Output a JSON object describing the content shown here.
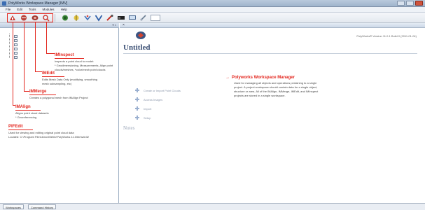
{
  "window": {
    "title": "PolyWorks Workspace Manager [IMV]",
    "controls": [
      "minimize",
      "maximize",
      "close"
    ]
  },
  "menu": [
    "File",
    "Edit",
    "Tools",
    "Modules",
    "Help"
  ],
  "toolbar": {
    "buttons": [
      {
        "icon": "imedit-icon"
      },
      {
        "icon": "imalign-icon"
      },
      {
        "icon": "immerge-icon"
      },
      {
        "icon": "iminspect-icon"
      },
      {
        "icon": "module-5-icon"
      },
      {
        "icon": "module-6-icon"
      },
      {
        "icon": "module-7-icon"
      },
      {
        "icon": "module-8-icon"
      },
      {
        "icon": "module-9-icon"
      },
      {
        "icon": "module-10-icon"
      }
    ]
  },
  "left_pane": {
    "header": "",
    "header_controls": "▾ ×",
    "tree": {
      "root": "",
      "items": [
        "",
        "",
        "",
        "",
        "",
        ""
      ]
    }
  },
  "callouts": [
    {
      "title": "IMInspect",
      "desc": [
        "Inspects a point cloud to model:",
        "* Geodimensioning, Measurements, Align point",
        "clouds/meshes, *color/mesh point clouds"
      ]
    },
    {
      "title": "IMEdit",
      "desc": [
        "Edits Mesh Data Only (modifying, smoothing",
        "mesh subsampling, etc)"
      ]
    },
    {
      "title": "IMMerge",
      "desc": [
        "Creates a polygonal mesh from IMAlign Project"
      ]
    },
    {
      "title": "IMAlign",
      "desc": [
        "Aligns point cloud datasets",
        "* Georeferencing"
      ]
    },
    {
      "title": "PIFEdit",
      "desc": [
        "Used for viewing and editing original point cloud data",
        "Located: C:\\Program Files\\InnovMetric\\PolyWorks 11.0\\bin\\win32"
      ]
    }
  ],
  "right_pane": {
    "header": "",
    "version": "PolyWorks® Version 11.0.1 Build 0 (2011-01-04)",
    "title": "Untitled",
    "location": "",
    "description_heading": "",
    "get_to_heading": "",
    "links": [
      "Create or Import Point Clouds",
      "Access Images",
      "Import",
      "Setup"
    ],
    "notes_heading": "Notes",
    "pw_callout": {
      "title": "Polyworks Workspace Manager",
      "desc": [
        "Used for managing all objects and operations pertaining to a single",
        "project. A project workspace should contain data for a single object,",
        "structure or area. All of the IMAlign, IMMerge, IMEdit, and IMInspect",
        "projects are stored in a single workspace."
      ]
    }
  },
  "bottom_tabs": [
    "Workspaces",
    "Command History"
  ],
  "colors": {
    "accent": "#e3271f",
    "selection": "#3472c9",
    "title": "#3a4f74"
  }
}
